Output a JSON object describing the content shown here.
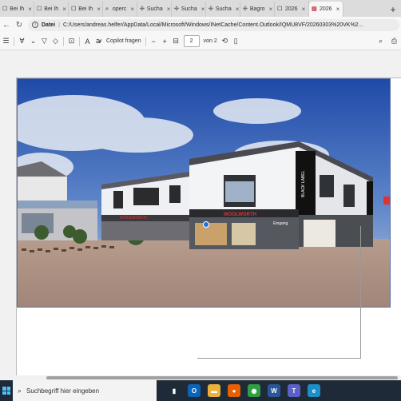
{
  "browser": {
    "tabs": [
      {
        "label": "Bei Ih",
        "icon": "page-icon"
      },
      {
        "label": "Bei Ih",
        "icon": "page-icon"
      },
      {
        "label": "Bei Ih",
        "icon": "page-icon"
      },
      {
        "label": "operc",
        "icon": "search-icon"
      },
      {
        "label": "Sucha",
        "icon": "app-icon"
      },
      {
        "label": "Sucha",
        "icon": "app-icon"
      },
      {
        "label": "Sucha",
        "icon": "app-icon"
      },
      {
        "label": "Bagro",
        "icon": "app-icon"
      },
      {
        "label": "2026",
        "icon": "page-icon"
      },
      {
        "label": "2026",
        "icon": "pdf-icon",
        "active": true
      }
    ],
    "new_tab": "+",
    "address": {
      "site_label": "Datei",
      "url": "C:/Users/andreas.helfer/AppData/Local/Microsoft/Windows/INetCache/Content.Outlook/IQMU8VF/20260303%20VK%2..."
    }
  },
  "pdf_toolbar": {
    "copilot_label": "Copilot fragen",
    "zoom_out": "−",
    "zoom_in": "+",
    "page_value": "2",
    "page_of": "von 2"
  },
  "building": {
    "sign_woolworth": "WOOLWORTH",
    "sign_shop": "WOOLWORTH",
    "sign_black": "BLACK LABEL",
    "sign_eingang": "Eingang"
  },
  "taskbar": {
    "search_placeholder": "Suchbegriff hier eingeben",
    "apps": [
      {
        "name": "task-view-icon",
        "color": "#1f2a38",
        "glyph": "▮"
      },
      {
        "name": "outlook-icon",
        "color": "#0a64b8",
        "glyph": "O"
      },
      {
        "name": "file-explorer-icon",
        "color": "#e8b23c",
        "glyph": "▬"
      },
      {
        "name": "firefox-icon",
        "color": "#e66000",
        "glyph": "●"
      },
      {
        "name": "chrome-icon",
        "color": "#2f9e44",
        "glyph": "◉"
      },
      {
        "name": "word-icon",
        "color": "#2b579a",
        "glyph": "W"
      },
      {
        "name": "teams-icon",
        "color": "#5b5fc7",
        "glyph": "T"
      },
      {
        "name": "edge-icon",
        "color": "#1b8fc7",
        "glyph": "e"
      }
    ]
  }
}
